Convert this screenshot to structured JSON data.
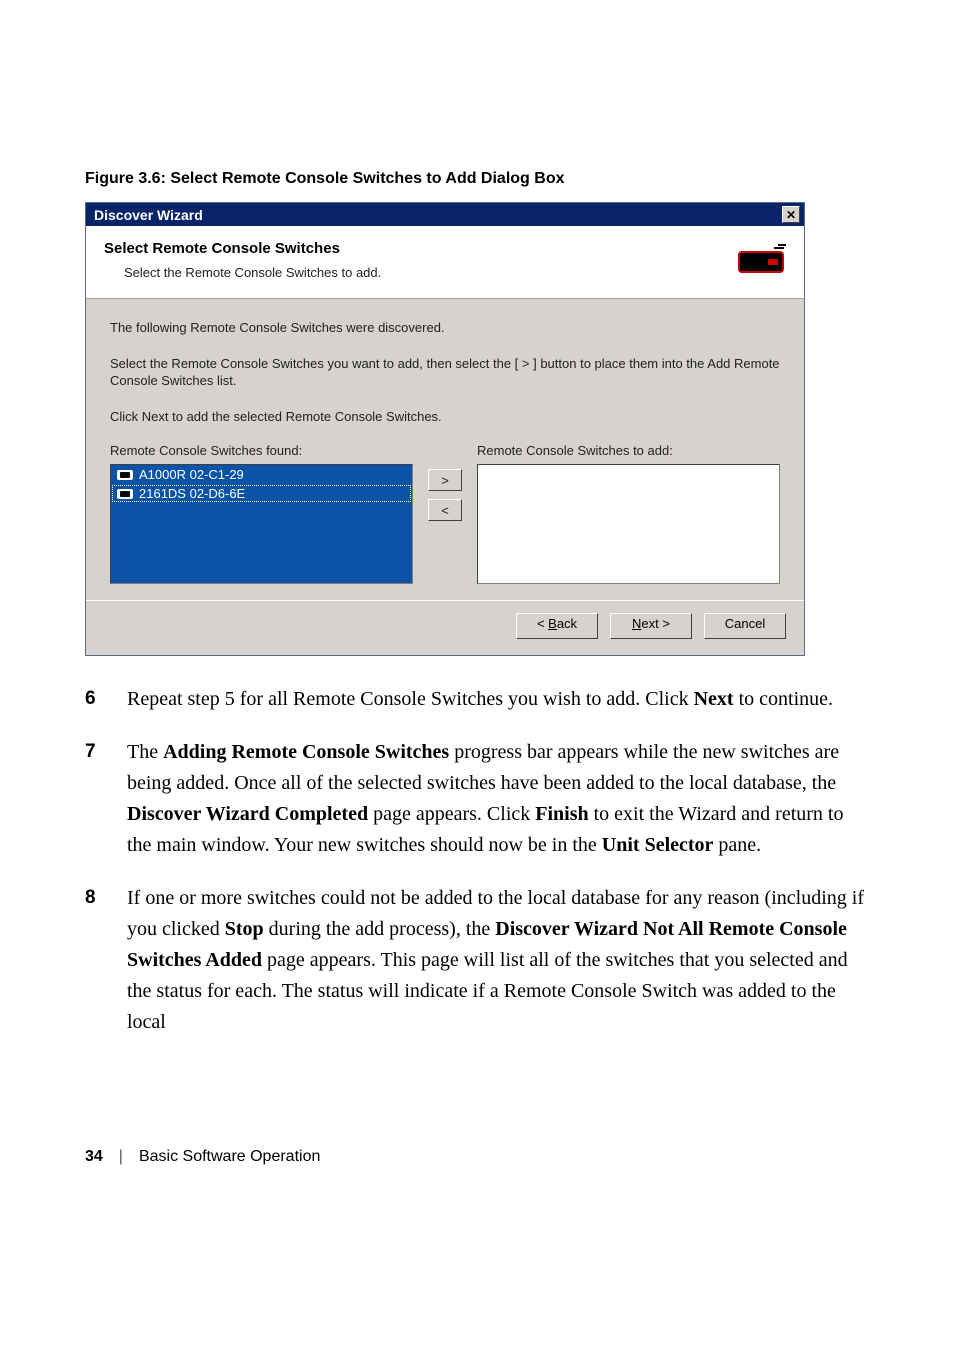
{
  "figure_caption": "Figure 3.6: Select Remote Console Switches to Add Dialog Box",
  "dialog": {
    "title": "Discover Wizard",
    "close_glyph": "✕",
    "heading": "Select Remote Console Switches",
    "subheading": "Select the Remote Console Switches to add.",
    "para1": "The following Remote Console Switches were discovered.",
    "para2": "Select the Remote Console Switches you want to add, then select the [ > ] button to place them into the Add Remote Console Switches list.",
    "para3": "Click Next to add the selected Remote Console Switches.",
    "found_label": "Remote Console Switches found:",
    "toadd_label": "Remote Console Switches to add:",
    "found_items": [
      "A1000R 02-C1-29",
      "2161DS 02-D6-6E"
    ],
    "move_right": ">",
    "move_left": "<",
    "back_label": "< Back",
    "next_label": "Next >",
    "cancel_label": "Cancel"
  },
  "steps": {
    "s6": {
      "num": "6",
      "t1": "Repeat step 5 for all Remote Console Switches you wish to add. Click ",
      "b1": "Next",
      "t2": " to continue."
    },
    "s7": {
      "num": "7",
      "t1": "The ",
      "b1": "Adding Remote Console Switches",
      "t2": " progress bar appears while the new switches are being added. Once all of the selected switches have been added to the local database, the ",
      "b2": "Discover Wizard Completed",
      "t3": " page appears. Click ",
      "b3": "Finish",
      "t4": " to exit the Wizard and return to the main window. Your new switches should now be in the ",
      "b4": "Unit Selector",
      "t5": " pane."
    },
    "s8": {
      "num": "8",
      "t1": "If one or more switches could not be added to the local database for any reason (including if you clicked ",
      "b1": "Stop",
      "t2": " during the add process), the ",
      "b2": "Discover Wizard Not All Remote Console Switches Added",
      "t3": " page appears. This page will list all of the switches that you selected and the status for each. The status will indicate if a Remote Console Switch was added to the local"
    }
  },
  "footer": {
    "page": "34",
    "sep": "|",
    "section": "Basic Software Operation"
  }
}
